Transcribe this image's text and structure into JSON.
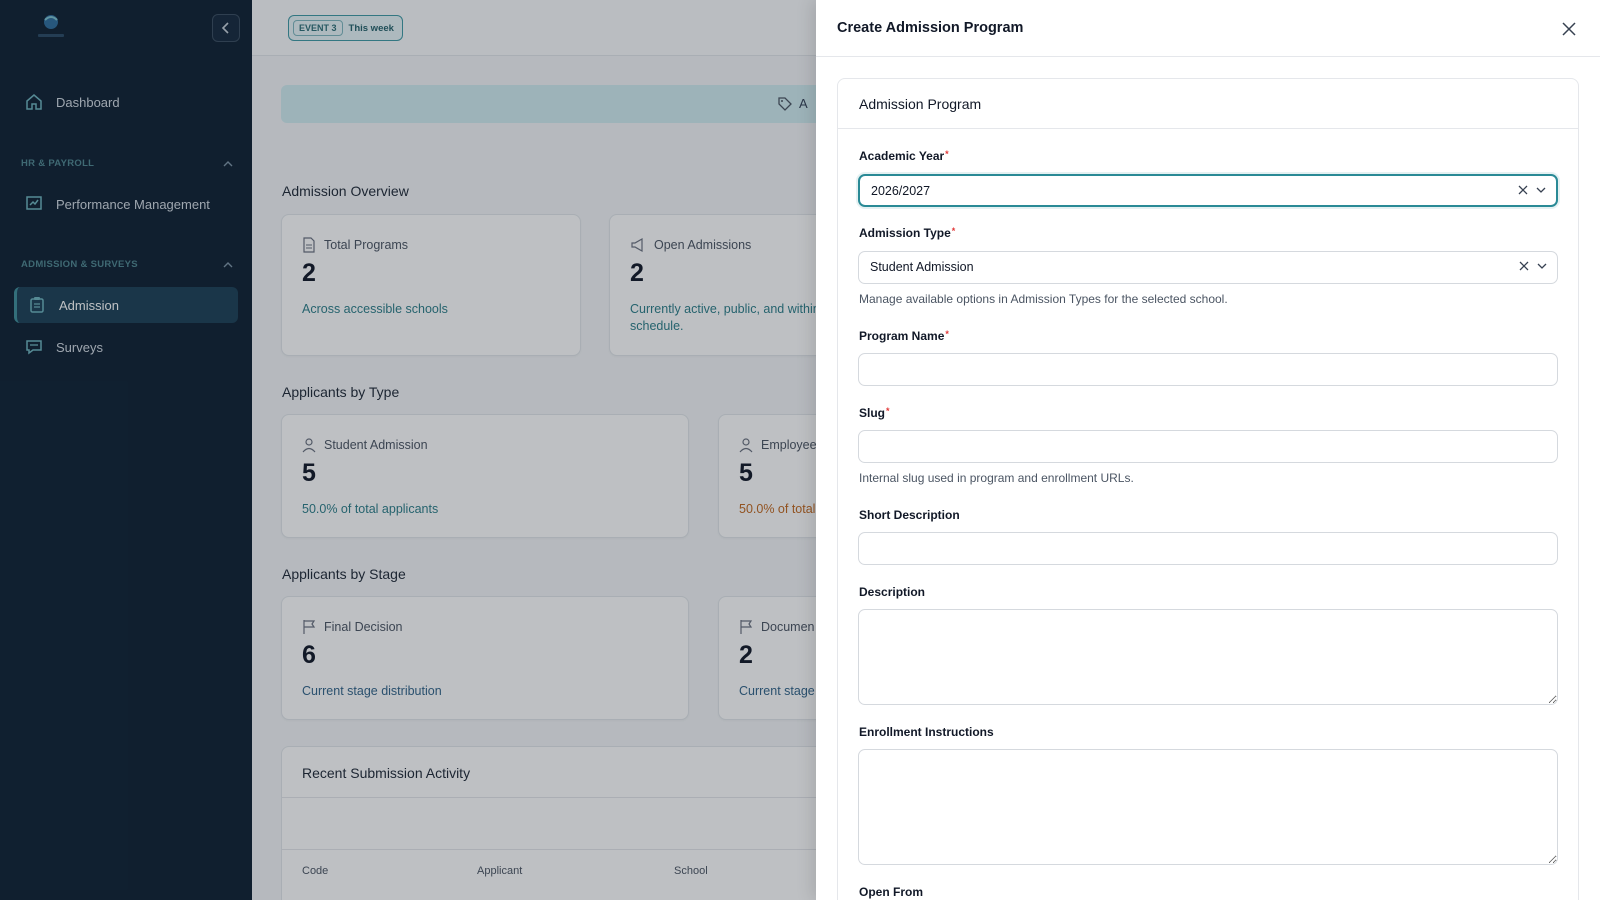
{
  "sidebar": {
    "dashboard": "Dashboard",
    "section_hr": "HR & PAYROLL",
    "performance": "Performance Management",
    "section_admission": "ADMISSION & SURVEYS",
    "admission": "Admission",
    "surveys": "Surveys"
  },
  "topbar": {
    "event_label": "EVENT 3",
    "week_label": "This week"
  },
  "banner": {
    "text": "A"
  },
  "overview": {
    "title": "Admission Overview",
    "cards": [
      {
        "title": "Total Programs",
        "value": "2",
        "sub": "Across accessible schools"
      },
      {
        "title": "Open Admissions",
        "value": "2",
        "sub": "Currently active, public, and within schedule."
      }
    ]
  },
  "by_type": {
    "title": "Applicants by Type",
    "cards": [
      {
        "title": "Student Admission",
        "value": "5",
        "sub": "50.0% of total applicants"
      },
      {
        "title": "Employee",
        "value": "5",
        "sub": "50.0% of total"
      }
    ]
  },
  "by_stage": {
    "title": "Applicants by Stage",
    "cards": [
      {
        "title": "Final Decision",
        "value": "6",
        "sub": "Current stage distribution"
      },
      {
        "title": "Documen",
        "value": "2",
        "sub": "Current stage"
      }
    ]
  },
  "recent": {
    "title": "Recent Submission Activity",
    "columns": [
      "Code",
      "Applicant",
      "School"
    ]
  },
  "drawer": {
    "title": "Create Admission Program",
    "card_title": "Admission Program",
    "academic_year_label": "Academic Year",
    "academic_year_value": "2026/2027",
    "admission_type_label": "Admission Type",
    "admission_type_value": "Student Admission",
    "admission_type_help": "Manage available options in Admission Types for the selected school.",
    "program_name_label": "Program Name",
    "slug_label": "Slug",
    "slug_help": "Internal slug used in program and enrollment URLs.",
    "short_description_label": "Short Description",
    "description_label": "Description",
    "enrollment_instructions_label": "Enrollment Instructions",
    "open_from_label": "Open From"
  },
  "colors": {
    "sidebar_bg": "#0f2133",
    "accent": "#2a8a96",
    "required": "#e23a3a"
  }
}
